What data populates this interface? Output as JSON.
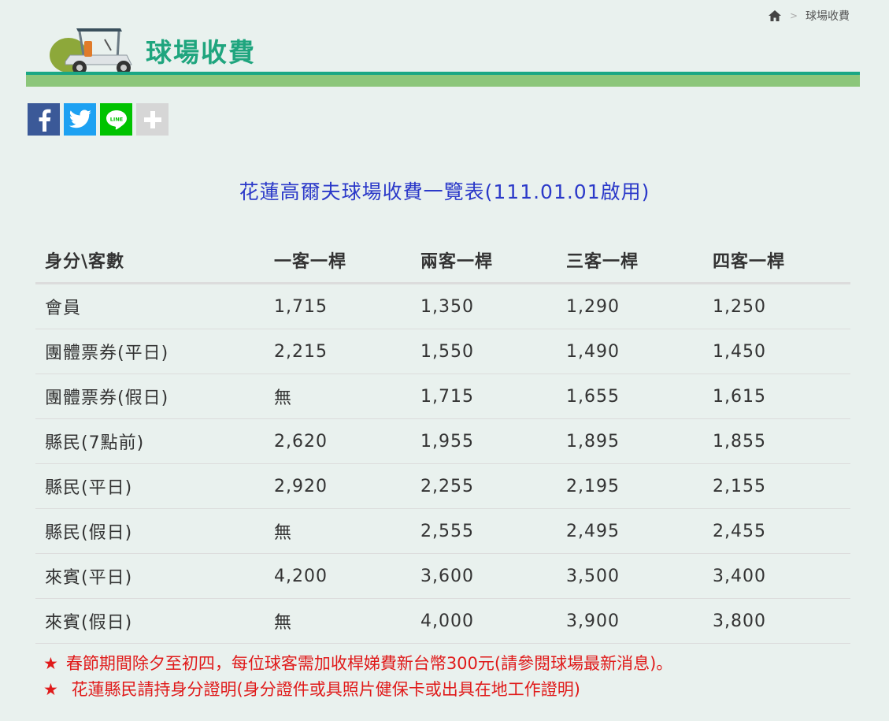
{
  "breadcrumb": {
    "home_icon": "home-icon",
    "separator": ">",
    "current": "球場收費"
  },
  "header": {
    "title": "球場收費",
    "logo_icon": "golf-cart-icon",
    "colors": {
      "title": "#1fa57e",
      "bar_top": "#1aa784",
      "bar_bottom": "#8cc67a"
    }
  },
  "share": {
    "items": [
      {
        "icon": "facebook-icon",
        "color": "#3b5998"
      },
      {
        "icon": "twitter-icon",
        "color": "#1da1f2"
      },
      {
        "icon": "line-icon",
        "color": "#00c300",
        "label": "LINE"
      },
      {
        "icon": "plus-icon",
        "color": "#d6d6d6"
      }
    ]
  },
  "table": {
    "title": "花蓮高爾夫球場收費一覽表(111.01.01啟用)",
    "headers": [
      "身分\\客數",
      "一客一桿",
      "兩客一桿",
      "三客一桿",
      "四客一桿"
    ],
    "rows": [
      [
        "會員",
        "1,715",
        "1,350",
        "1,290",
        "1,250"
      ],
      [
        "團體票券(平日)",
        "2,215",
        "1,550",
        "1,490",
        "1,450"
      ],
      [
        "團體票券(假日)",
        "無",
        "1,715",
        "1,655",
        "1,615"
      ],
      [
        "縣民(7點前)",
        "2,620",
        "1,955",
        "1,895",
        "1,855"
      ],
      [
        "縣民(平日)",
        "2,920",
        "2,255",
        "2,195",
        "2,155"
      ],
      [
        "縣民(假日)",
        "無",
        "2,555",
        "2,495",
        "2,455"
      ],
      [
        "來賓(平日)",
        "4,200",
        "3,600",
        "3,500",
        "3,400"
      ],
      [
        "來賓(假日)",
        "無",
        "4,000",
        "3,900",
        "3,800"
      ]
    ]
  },
  "notes": {
    "star": "★",
    "items": [
      "春節期間除夕至初四，每位球客需加收桿娣費新台幣300元(請參閱球場最新消息)。",
      " 花蓮縣民請持身分證明(身分證件或具照片健保卡或出具在地工作證明)"
    ]
  }
}
